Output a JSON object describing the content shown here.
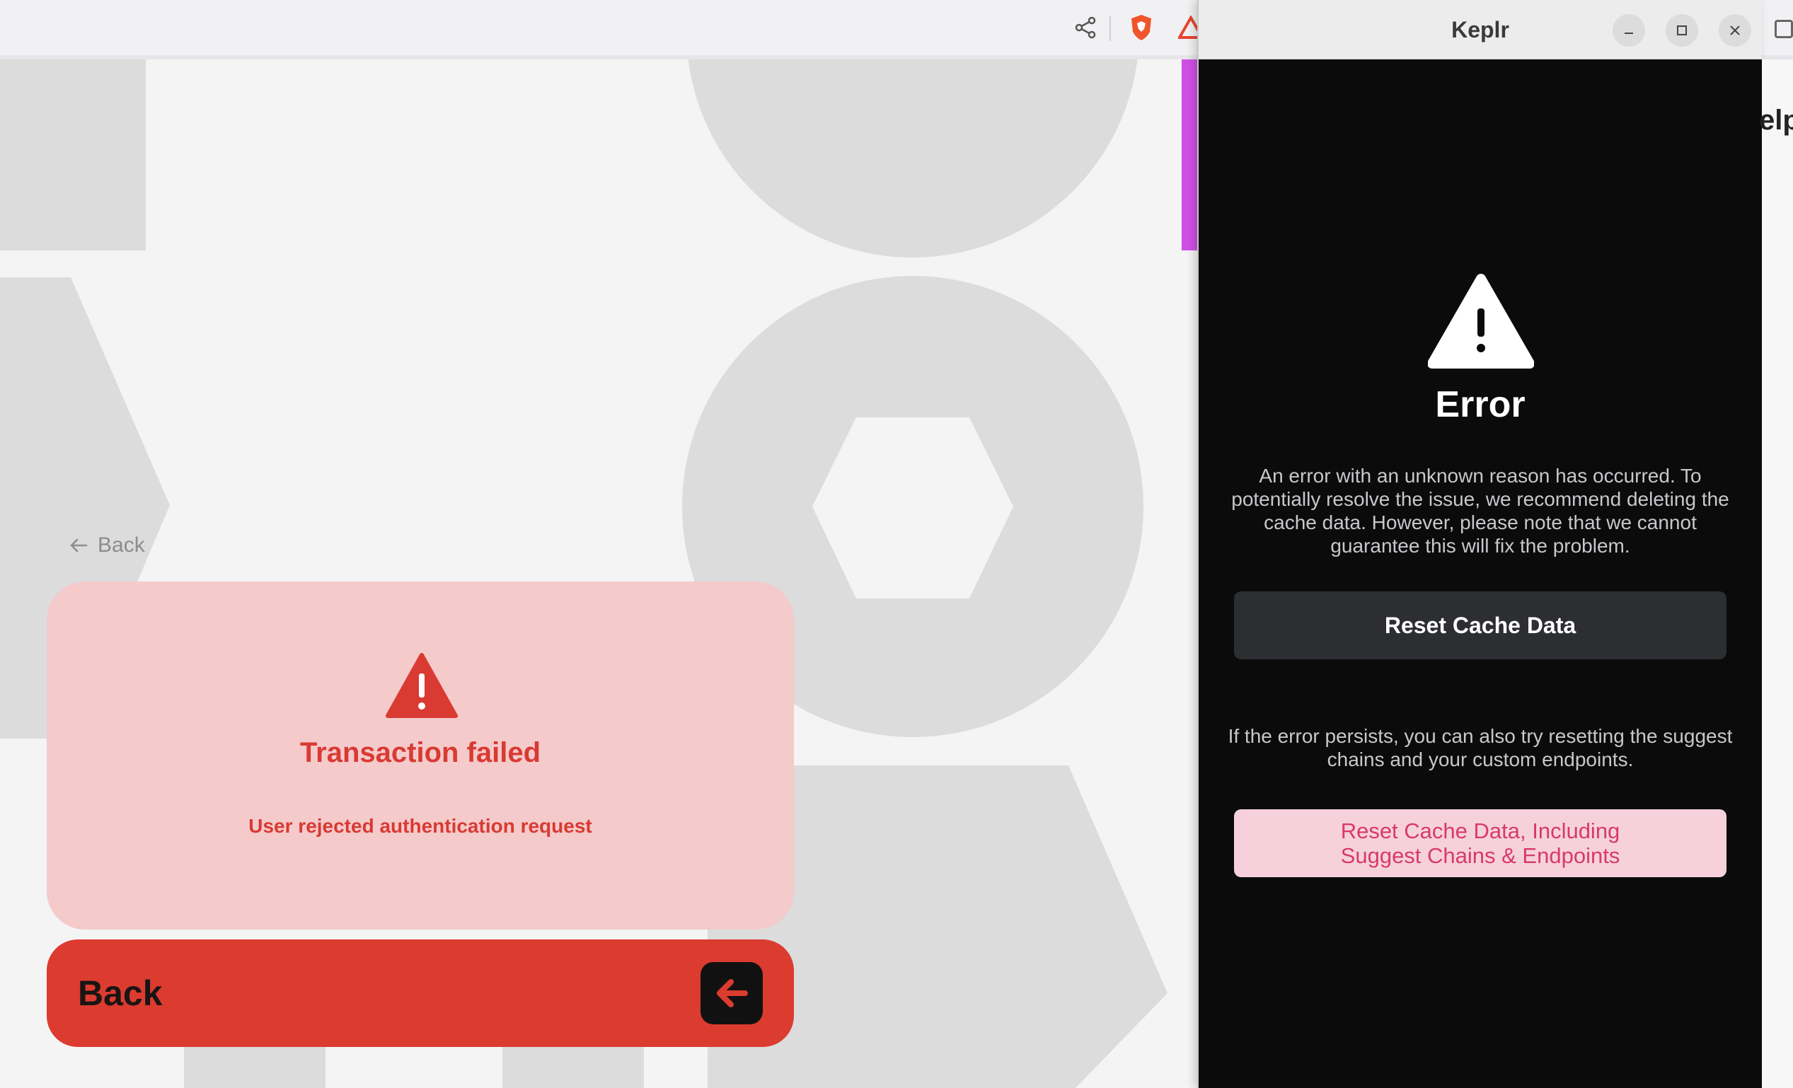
{
  "browser": {
    "icons": [
      "share-icon",
      "brave-shield-icon",
      "brave-rewards-icon"
    ]
  },
  "back_link": {
    "label": "Back"
  },
  "transaction": {
    "title": "Transaction failed",
    "message": "User rejected authentication request",
    "back_button_label": "Back",
    "colors": {
      "card": "#f4cacb",
      "accent": "#dc3b2f"
    }
  },
  "keplr_window": {
    "title": "Keplr",
    "error_title": "Error",
    "error_description": "An error with an unknown reason has occurred. To potentially resolve the issue, we recommend deleting the cache data. However, please note that we cannot guarantee this will fix the problem.",
    "reset_cache_button": "Reset Cache Data",
    "persist_text": "If the error persists, you can also try resetting the suggest chains and your custom endpoints.",
    "reset_all_button": "Reset Cache Data, Including Suggest Chains & Endpoints",
    "colors": {
      "background": "#0b0b0c",
      "reset_all": "#f6d1dc",
      "reset_all_text": "#d83a66"
    }
  },
  "right_peek": {
    "text": "elp"
  }
}
